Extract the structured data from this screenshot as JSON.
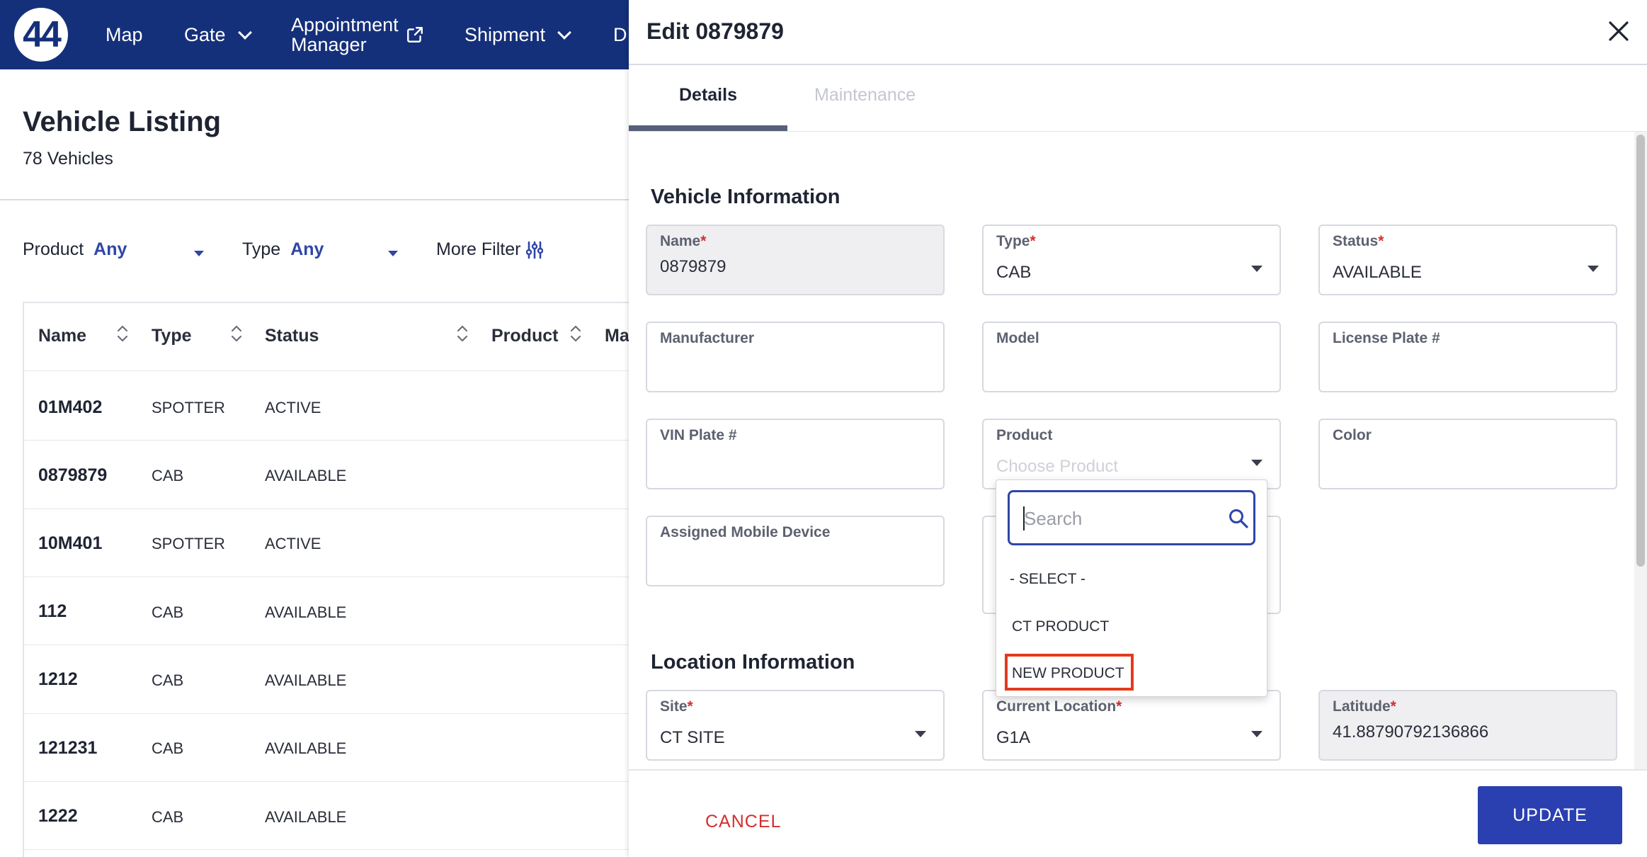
{
  "nav": {
    "logo_text": "44",
    "items": [
      {
        "label": "Map"
      },
      {
        "label": "Gate"
      },
      {
        "label_line1": "Appointment",
        "label_line2": "Manager"
      },
      {
        "label": "Shipment"
      },
      {
        "label": "D"
      }
    ]
  },
  "page": {
    "title": "Vehicle Listing",
    "subtitle": "78 Vehicles"
  },
  "filters": {
    "product_label": "Product",
    "product_value": "Any",
    "type_label": "Type",
    "type_value": "Any",
    "more_label": "More Filter"
  },
  "table": {
    "headers": [
      "Name",
      "Type",
      "Status",
      "Product",
      "Ma"
    ],
    "rows": [
      {
        "name": "01M402",
        "type": "SPOTTER",
        "status": "ACTIVE"
      },
      {
        "name": "0879879",
        "type": "CAB",
        "status": "AVAILABLE"
      },
      {
        "name": "10M401",
        "type": "SPOTTER",
        "status": "ACTIVE"
      },
      {
        "name": "112",
        "type": "CAB",
        "status": "AVAILABLE"
      },
      {
        "name": "1212",
        "type": "CAB",
        "status": "AVAILABLE"
      },
      {
        "name": "121231",
        "type": "CAB",
        "status": "AVAILABLE"
      },
      {
        "name": "1222",
        "type": "CAB",
        "status": "AVAILABLE"
      }
    ]
  },
  "modal": {
    "title": "Edit 0879879",
    "tabs": [
      "Details",
      "Maintenance"
    ],
    "vehicle_section": "Vehicle Information",
    "location_section": "Location Information",
    "fields": {
      "name": {
        "label": "Name",
        "value": "0879879"
      },
      "type": {
        "label": "Type",
        "value": "CAB"
      },
      "status": {
        "label": "Status",
        "value": "AVAILABLE"
      },
      "manufacturer": {
        "label": "Manufacturer"
      },
      "model": {
        "label": "Model"
      },
      "license": {
        "label": "License Plate #"
      },
      "vin": {
        "label": "VIN Plate #"
      },
      "product": {
        "label": "Product",
        "placeholder": "Choose Product"
      },
      "color": {
        "label": "Color"
      },
      "mobile": {
        "label": "Assigned Mobile Device"
      },
      "site": {
        "label": "Site",
        "value": "CT SITE"
      },
      "current_location": {
        "label": "Current Location",
        "value": "G1A"
      },
      "latitude": {
        "label": "Latitude",
        "value": "41.88790792136866"
      }
    },
    "required_mark": "*",
    "cancel_label": "CANCEL",
    "update_label": "UPDATE"
  },
  "dropdown": {
    "search_placeholder": "Search",
    "options": [
      "- SELECT -",
      "CT PRODUCT",
      "NEW PRODUCT"
    ],
    "highlighted": "NEW PRODUCT"
  },
  "colors": {
    "nav_bg": "#15307a",
    "accent": "#2e46a8",
    "primary_button": "#2a3fb0",
    "danger": "#d32f2f",
    "highlight_box": "#e23a1e"
  },
  "icons": [
    "external-link-icon",
    "chevron-down-icon",
    "sliders-icon",
    "sort-icon",
    "close-icon",
    "caret-down-icon",
    "search-icon"
  ]
}
